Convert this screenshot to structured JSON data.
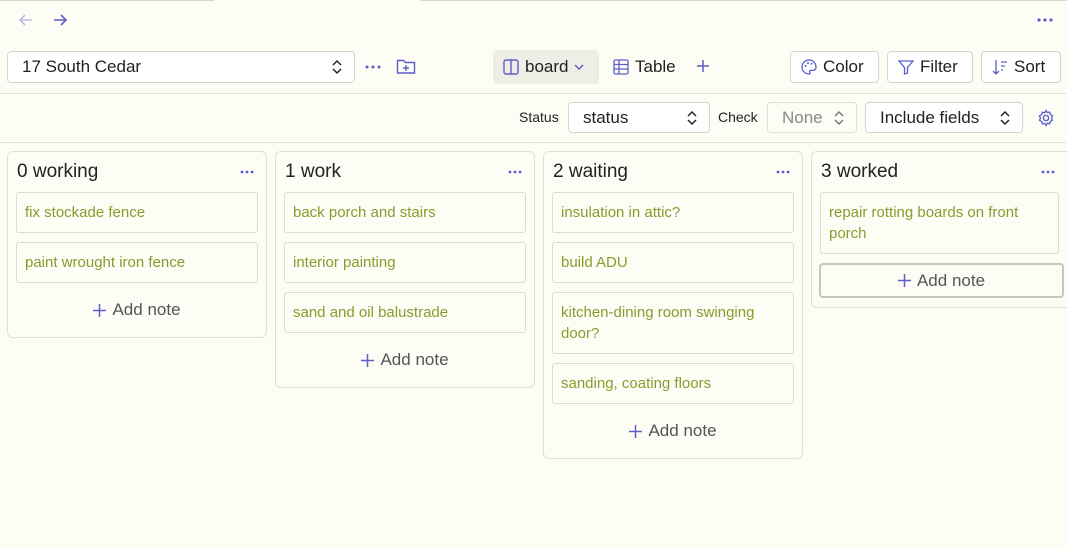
{
  "nav": {
    "back_icon": "arrow-left-icon",
    "forward_icon": "arrow-right-icon"
  },
  "toolbar": {
    "file_select": "17 South Cedar",
    "views": [
      {
        "label": "board",
        "icon": "columns-icon",
        "active": true
      },
      {
        "label": "Table",
        "icon": "table-icon",
        "active": false
      }
    ],
    "color_label": "Color",
    "filter_label": "Filter",
    "sort_label": "Sort"
  },
  "filters": {
    "status_label": "Status",
    "status_value": "status",
    "check_label": "Check",
    "check_value": "None",
    "include_fields": "Include fields"
  },
  "columns": [
    {
      "title": "0 working",
      "cards": [
        "fix stockade fence",
        "paint wrought iron fence"
      ],
      "add_label": "Add note"
    },
    {
      "title": "1 work",
      "cards": [
        "back porch and stairs",
        "interior painting",
        "sand and oil balustrade"
      ],
      "add_label": "Add note"
    },
    {
      "title": "2 waiting",
      "cards": [
        "insulation in attic?",
        "build ADU",
        "kitchen-dining room swinging door?",
        "sanding, coating floors"
      ],
      "add_label": "Add note"
    },
    {
      "title": "3 worked",
      "cards": [
        "repair rotting boards on front porch"
      ],
      "add_label": "Add note"
    }
  ],
  "colors": {
    "accent": "#5b5fc7",
    "card_text": "#8a9a2e",
    "background": "#fefdf5"
  }
}
